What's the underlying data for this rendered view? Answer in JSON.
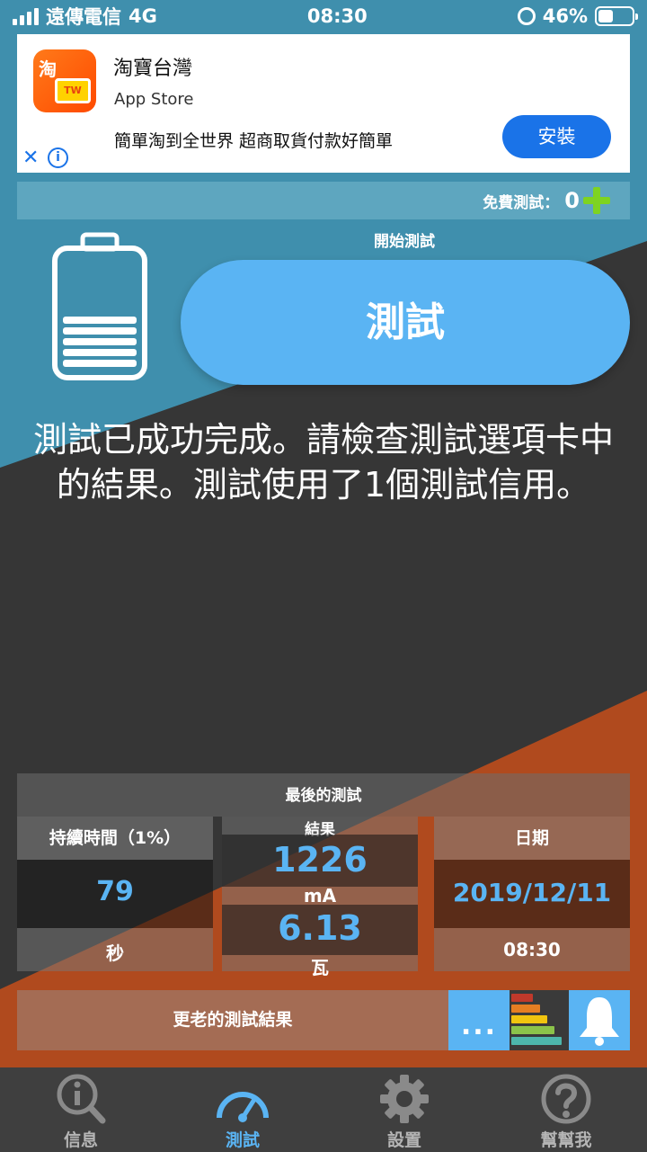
{
  "status_bar": {
    "carrier": "遠傳電信",
    "network": "4G",
    "time": "08:30",
    "battery_percent": "46%"
  },
  "ad": {
    "app_name": "淘寶台灣",
    "logo_text": "淘",
    "logo_badge": "TW",
    "store": "App Store",
    "description": "簡單淘到全世界 超商取貨付款好簡單",
    "install_label": "安裝",
    "close_symbol": "✕",
    "info_symbol": "i"
  },
  "free_test": {
    "label": "免費測試：",
    "count": "0"
  },
  "test": {
    "start_label": "開始測試",
    "button_label": "測試",
    "message": "測試已成功完成。請檢查測試選項卡中的結果。測試使用了1個測試信用。"
  },
  "last_test": {
    "title": "最後的測試",
    "duration_header": "持續時間（1%）",
    "duration_value": "79",
    "duration_unit": "秒",
    "result_header": "結果",
    "result_current": "1226",
    "result_current_unit": "mA",
    "result_power": "6.13",
    "result_power_unit": "瓦",
    "date_header": "日期",
    "date_value": "2019/12/11",
    "time_value": "08:30"
  },
  "older": {
    "label": "更老的測試結果",
    "more_symbol": "..."
  },
  "tabs": [
    {
      "label": "信息",
      "icon": "info-search-icon",
      "active": false
    },
    {
      "label": "測試",
      "icon": "speedometer-icon",
      "active": true
    },
    {
      "label": "設置",
      "icon": "gear-icon",
      "active": false
    },
    {
      "label": "幫幫我",
      "icon": "question-icon",
      "active": false
    }
  ],
  "colors": {
    "accent_blue": "#5ab4f3",
    "teal": "#3f8fad",
    "orange": "#b04a1e",
    "dark": "#363636",
    "plus_green": "#7ed321"
  }
}
